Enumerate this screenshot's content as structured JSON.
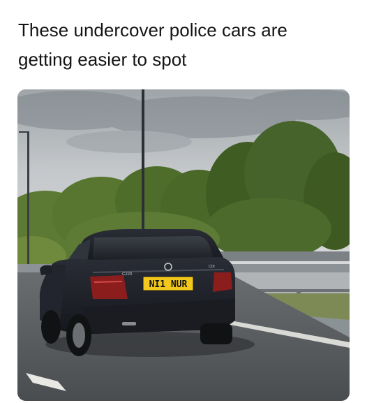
{
  "post": {
    "caption_line_1": "These undercover police cars are",
    "caption_line_2": "getting easier to spot"
  },
  "photo": {
    "subject": "dark-sedan-on-highway",
    "plate_text": "NI1 NUR",
    "badge_left": "C220",
    "badge_right": "CDI"
  },
  "colors": {
    "plate_yellow": "#f2c81d",
    "car_body": "#1b1d24",
    "sky": "#c9cdd0",
    "foliage": "#4d6b2c",
    "road": "#55585b"
  }
}
